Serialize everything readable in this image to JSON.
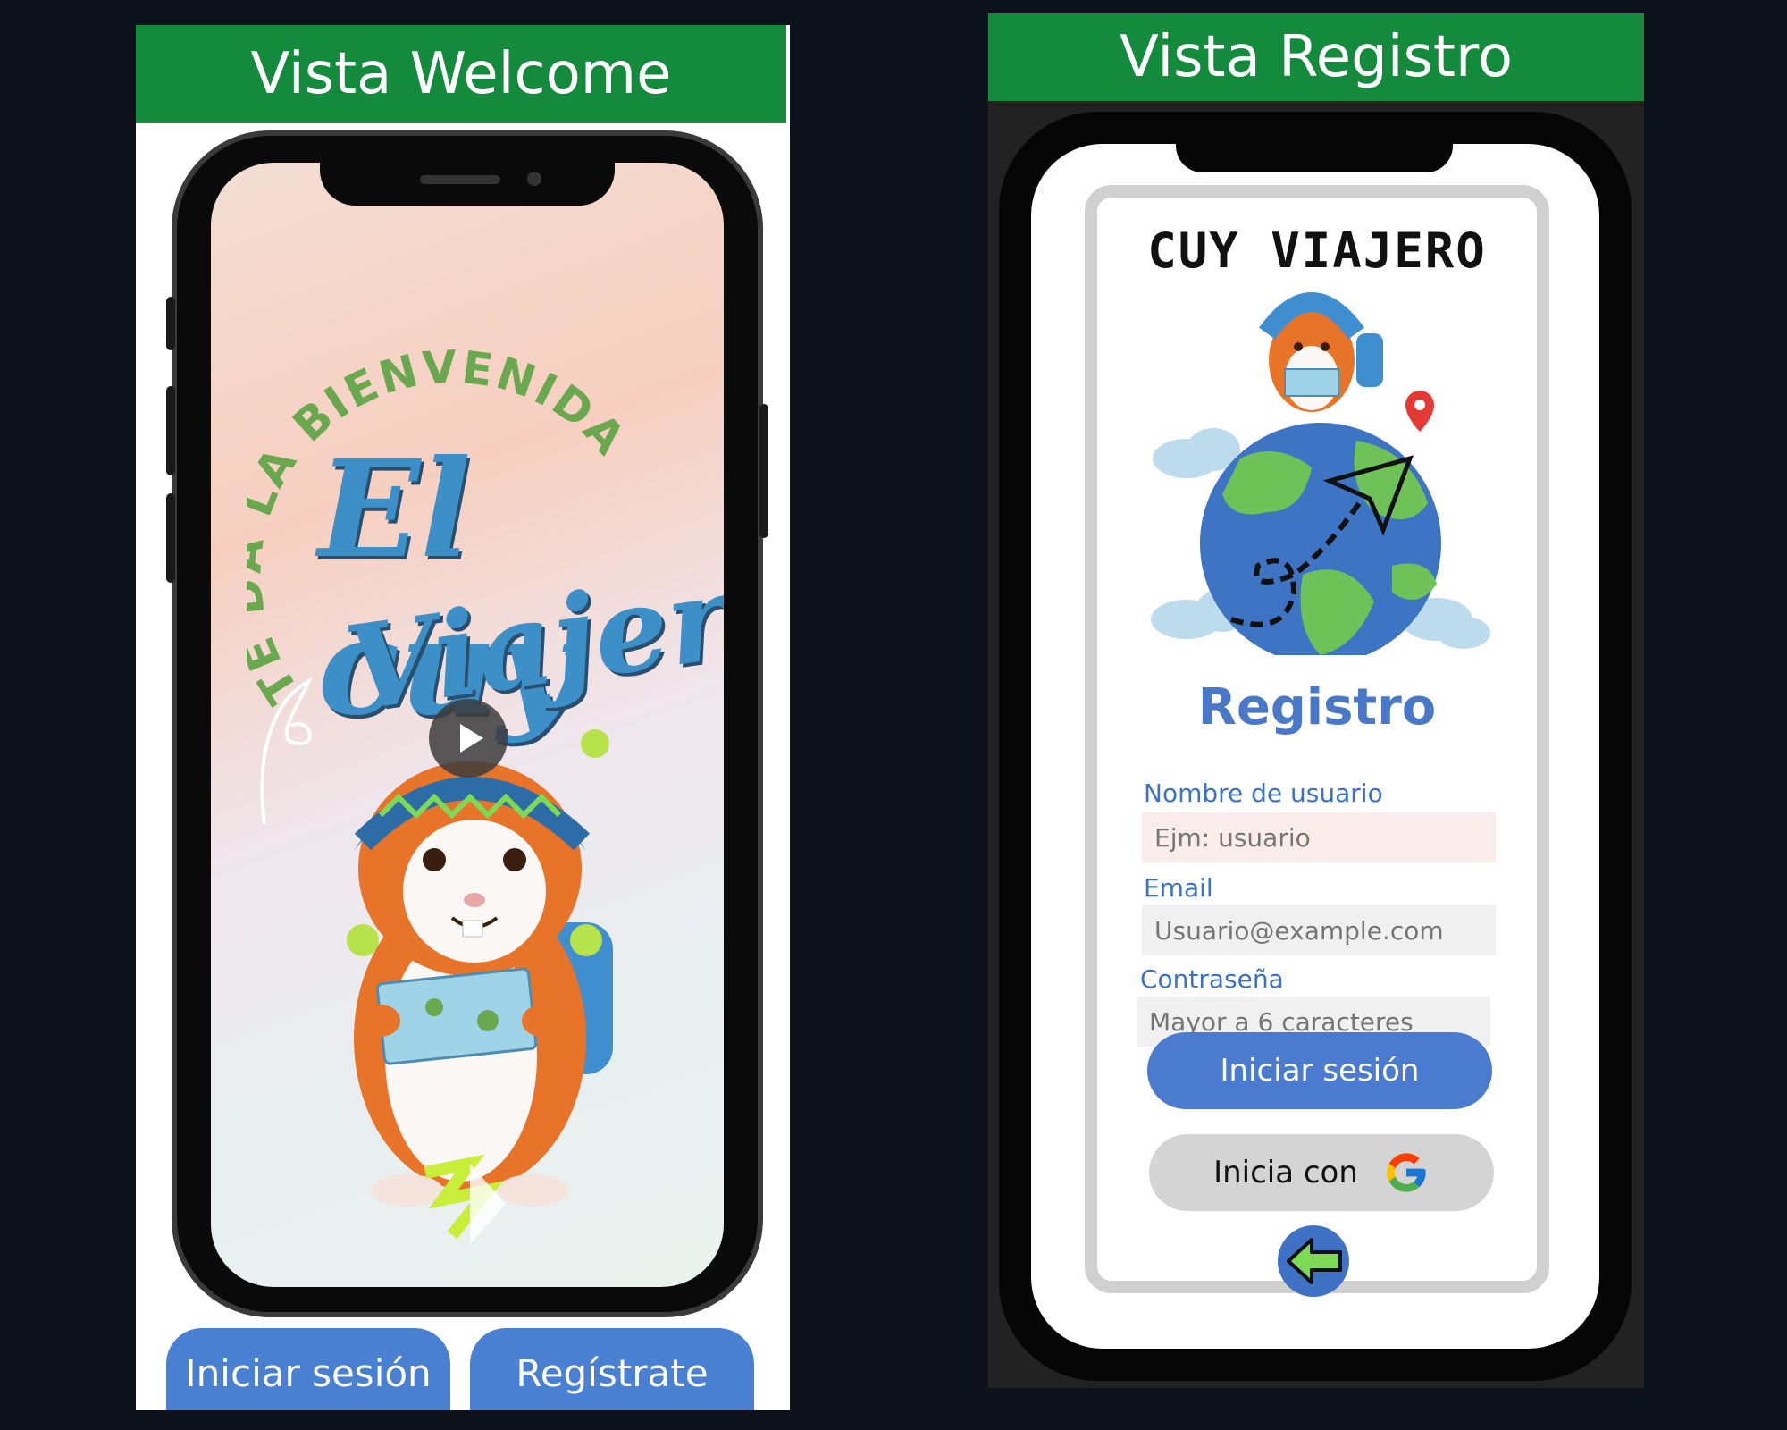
{
  "left": {
    "banner_title": "Vista Welcome",
    "arc_text": "TE DA LA BIENVENIDA",
    "script_line1": "El cuy",
    "script_line2": "Viajero",
    "buttons": {
      "login_label": "Iniciar sesión",
      "register_label": "Regístrate"
    },
    "colors": {
      "banner": "#138a3c",
      "button": "#4a80d2",
      "script": "#3d8fc8",
      "arc": "#6aa84f"
    }
  },
  "right": {
    "banner_title": "Vista Registro",
    "brand": "CUY VIAJERO",
    "form_title": "Registro",
    "fields": [
      {
        "label": "Nombre de usuario",
        "placeholder": "Ejm: usuario"
      },
      {
        "label": "Email",
        "placeholder": "Usuario@example.com"
      },
      {
        "label": "Contraseña",
        "placeholder": "Mayor a 6 caracteres"
      }
    ],
    "login_label": "Iniciar sesión",
    "google_label": "Inicia con",
    "icons": {
      "google": "google-icon",
      "back": "back-arrow-icon",
      "globe": "globe-illustration"
    },
    "colors": {
      "banner": "#138a3c",
      "accent": "#4a7bcf",
      "label": "#3a73c6",
      "google_btn": "#d4d4d4"
    }
  }
}
